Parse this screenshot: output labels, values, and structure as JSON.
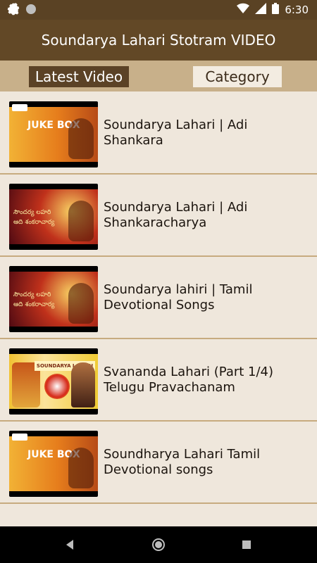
{
  "status_bar": {
    "time": "6:30",
    "left_icons": [
      "settings-icon",
      "circle-notification-icon"
    ],
    "right_icons": [
      "wifi-icon",
      "signal-icon",
      "battery-icon"
    ]
  },
  "app_bar": {
    "title": "Soundarya Lahari Stotram VIDEO"
  },
  "tabs": [
    {
      "label": "Latest Video",
      "selected": true
    },
    {
      "label": "Category",
      "selected": false
    }
  ],
  "videos": [
    {
      "title": "Soundarya Lahari | Adi Shankara",
      "thumb_caption": "JUKE BOX"
    },
    {
      "title": "Soundarya Lahari | Adi Shankaracharya",
      "thumb_caption": "సౌందర్య లహరి ఆది శంకరాచార్య"
    },
    {
      "title": "Soundarya lahiri | Tamil Devotional Songs",
      "thumb_caption": "సౌందర్య లహరి ఆది శంకరాచార్య"
    },
    {
      "title": "Svananda Lahari (Part 1/4) Telugu Pravachanam",
      "thumb_caption": "SOUNDARYA LAHARI"
    },
    {
      "title": "Soundharya Lahari Tamil Devotional songs",
      "thumb_caption": "JUKE BOX"
    }
  ],
  "colors": {
    "status_bar": "#5a4224",
    "app_bar": "#624826",
    "tab_strip": "#c8b08a",
    "tab_selected": "#5b4226",
    "tab_unselected": "#f3ece1",
    "list_bg": "#efe7dc",
    "divider": "#c7ab7f",
    "nav_bar": "#000000"
  },
  "nav_bar": {
    "buttons": [
      "back-icon",
      "home-icon",
      "recents-icon"
    ]
  }
}
